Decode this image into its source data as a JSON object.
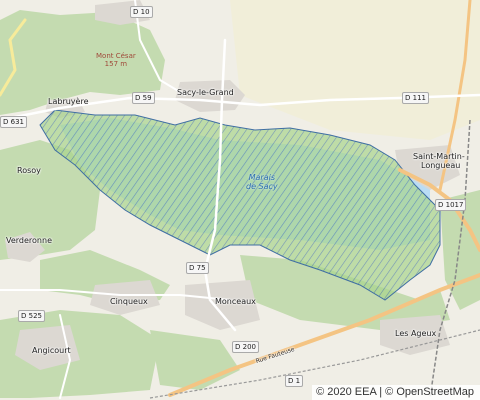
{
  "map": {
    "place_labels": {
      "sacy": "Sacy-le-Grand",
      "labruyere": "Labruyère",
      "rosoy": "Rosoy",
      "verderonne": "Verderonne",
      "cinqueux": "Cinqueux",
      "monceaux": "Monceaux",
      "angicourt": "Angicourt",
      "saint_martin_1": "Saint-Martin-",
      "saint_martin_2": "Longueau",
      "les_ageux": "Les Ageux"
    },
    "peak": {
      "name": "Mont César",
      "elevation": "157 m"
    },
    "marsh": {
      "line1": "Marais",
      "line2": "de Sacy"
    },
    "roads": {
      "d10": "D 10",
      "d59": "D 59",
      "d631": "D 631",
      "d111": "D 111",
      "d1017": "D 1017",
      "d75": "D 75",
      "d525": "D 525",
      "d200": "D 200",
      "d_partial": "D 1",
      "rue_fauteuse": "Rue Fauteuse"
    },
    "colors": {
      "background": "#f0eee6",
      "forest": "#c4dbb0",
      "marsh_water": "#b9dcf5",
      "hatch_stroke": "#3f6ea3",
      "hatch_fill": "#a9d58c",
      "urban": "#dcd8d2",
      "major_road": "#f4c483"
    }
  },
  "attribution": {
    "prefix": "© 2020 EEA",
    "separator": "|",
    "osm": "© OpenStreetMap"
  }
}
